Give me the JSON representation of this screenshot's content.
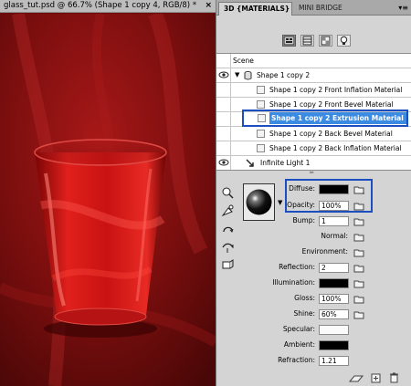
{
  "document": {
    "title": "glass_tut.psd @ 66.7% (Shape 1 copy 4, RGB/8) *",
    "close_glyph": "×",
    "colors": {
      "background_dark": "#5a0a0a",
      "background_mid": "#b01818",
      "glass_red": "#d11818"
    }
  },
  "panel": {
    "tabs": [
      {
        "label": "3D {MATERIALS}",
        "active": true
      },
      {
        "label": "MINI BRIDGE",
        "active": false
      }
    ],
    "menu_glyph": "▾≡",
    "filter_icons": [
      "scene-filter-icon",
      "mesh-filter-icon",
      "material-filter-icon",
      "light-filter-icon"
    ],
    "scene": {
      "header": "Scene",
      "rows": [
        {
          "label": "Shape 1 copy 2",
          "kind": "mesh",
          "visible": true
        },
        {
          "label": "Shape 1 copy 2 Front Inflation Material",
          "kind": "material",
          "visible": false
        },
        {
          "label": "Shape 1 copy 2 Front Bevel Material",
          "kind": "material",
          "visible": false
        },
        {
          "label": "Shape 1 copy 2 Extrusion Material",
          "kind": "material",
          "visible": false,
          "selected": true
        },
        {
          "label": "Shape 1 copy 2 Back Bevel Material",
          "kind": "material",
          "visible": false
        },
        {
          "label": "Shape 1 copy 2 Back Inflation Material",
          "kind": "material",
          "visible": false
        },
        {
          "label": "Infinite Light 1",
          "kind": "light",
          "visible": true
        }
      ]
    },
    "material": {
      "diffuse": {
        "label": "Diffuse:",
        "color": "#000000"
      },
      "opacity": {
        "label": "Opacity:",
        "value": "100%"
      },
      "bump": {
        "label": "Bump:",
        "value": "1"
      },
      "normal": {
        "label": "Normal:"
      },
      "environment": {
        "label": "Environment:"
      },
      "reflection": {
        "label": "Reflection:",
        "value": "2"
      },
      "illumination": {
        "label": "Illumination:",
        "color": "#000000"
      },
      "gloss": {
        "label": "Gloss:",
        "value": "100%"
      },
      "shine": {
        "label": "Shine:",
        "value": "60%"
      },
      "specular": {
        "label": "Specular:",
        "color": "#fafafa"
      },
      "ambient": {
        "label": "Ambient:",
        "color": "#000000"
      },
      "refraction": {
        "label": "Refraction:",
        "value": "1.21"
      }
    },
    "colors": {
      "selection": "#3b8be3",
      "callout_border": "#1b4fbf"
    }
  }
}
